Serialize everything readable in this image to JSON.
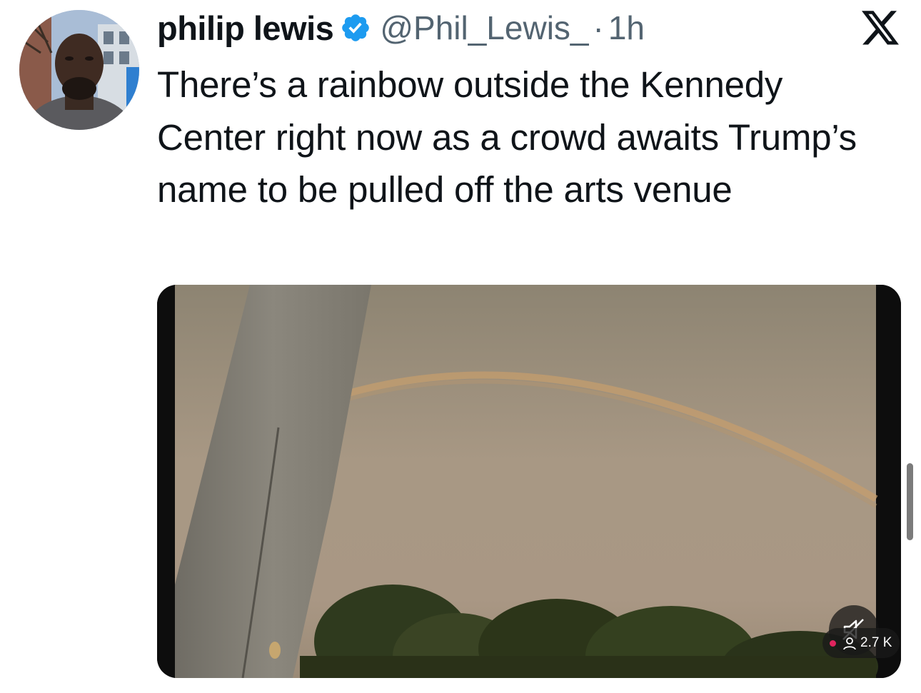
{
  "author": {
    "display_name": "philip lewis",
    "handle": "@Phil_Lewis_",
    "separator": "·",
    "time": "1h",
    "avatar_icon": "profile-photo",
    "verified_icon": "verified-badge-icon"
  },
  "tweet": {
    "text": "There’s a rainbow outside the Kennedy Center right now as a crowd awaits Trump’s name to be pulled off the arts venue"
  },
  "media": {
    "type": "video",
    "mute_icon": "muted-speaker-icon",
    "views": "2.7 K",
    "views_icon": "person-icon"
  },
  "toolbar": {
    "close_icon": "x-logo-icon"
  },
  "colors": {
    "text": "#0f1419",
    "secondary": "#536471",
    "verified": "#1d9bf0"
  }
}
